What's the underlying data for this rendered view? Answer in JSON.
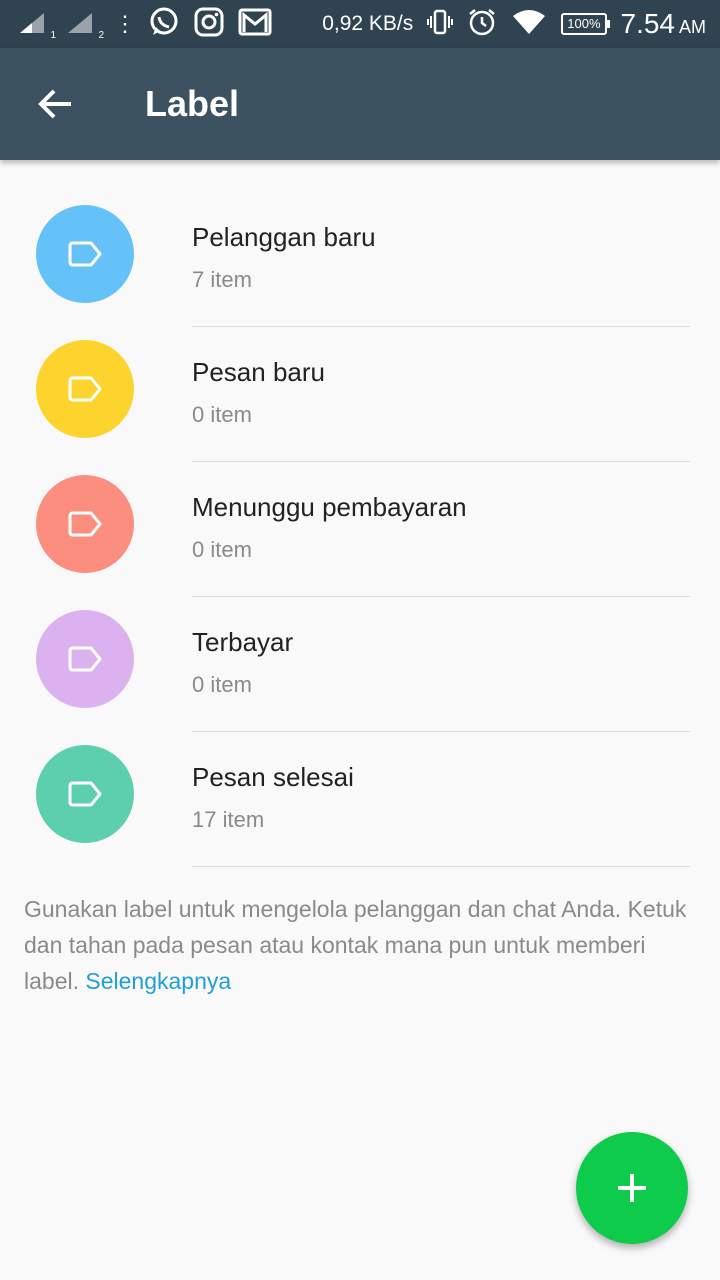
{
  "status_bar": {
    "sim1_label": "1",
    "sim2_label": "2",
    "overflow": "⋮",
    "speed": "0,92 KB/s",
    "battery": "100%",
    "time": "7.54",
    "ampm": "AM"
  },
  "toolbar": {
    "back_icon": "arrow-left",
    "title": "Label"
  },
  "labels": [
    {
      "name": "Pelanggan baru",
      "count": "7 item",
      "color": "#64c2f9"
    },
    {
      "name": "Pesan baru",
      "count": "0 item",
      "color": "#fdd32d"
    },
    {
      "name": "Menunggu pembayaran",
      "count": "0 item",
      "color": "#fb8e7e"
    },
    {
      "name": "Terbayar",
      "count": "0 item",
      "color": "#dcb1ef"
    },
    {
      "name": "Pesan selesai",
      "count": "17 item",
      "color": "#5dcfae"
    }
  ],
  "info": {
    "text": "Gunakan label untuk mengelola pelanggan dan chat Anda. Ketuk dan tahan pada pesan atau kontak mana pun untuk memberi label.",
    "link": "Selengkapnya"
  },
  "fab": {
    "icon": "plus",
    "color": "#0ecb4c"
  }
}
